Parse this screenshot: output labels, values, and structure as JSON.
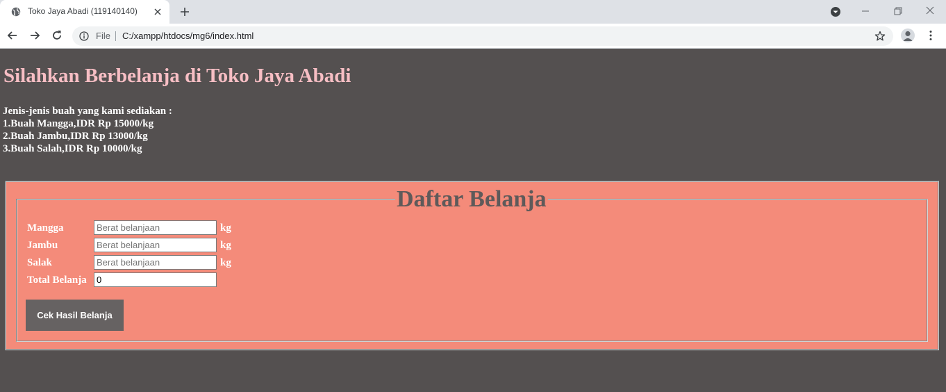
{
  "browser": {
    "tab_title": "Toko Jaya Abadi (119140140)",
    "address_scheme": "File",
    "url": "C:/xampp/htdocs/mg6/index.html"
  },
  "page": {
    "heading": "Silahkan Berbelanja di Toko Jaya Abadi",
    "intro": "Jenis-jenis buah yang kami sediakan :",
    "fruits": [
      "1.Buah Mangga,IDR Rp 15000/kg",
      "2.Buah Jambu,IDR Rp 13000/kg",
      "3.Buah Salah,IDR Rp 10000/kg"
    ],
    "colors": {
      "background": "#545050",
      "heading": "#f7bec4",
      "form_background": "#f48b7a",
      "legend": "#5e5a5a",
      "button": "#666262"
    }
  },
  "form": {
    "legend": "Daftar Belanja",
    "rows": [
      {
        "label": "Mangga",
        "placeholder": "Berat belanjaan",
        "value": "",
        "unit": "kg"
      },
      {
        "label": "Jambu",
        "placeholder": "Berat belanjaan",
        "value": "",
        "unit": "kg"
      },
      {
        "label": "Salak",
        "placeholder": "Berat belanjaan",
        "value": "",
        "unit": "kg"
      }
    ],
    "total": {
      "label": "Total Belanja",
      "value": "0"
    },
    "button_label": "Cek Hasil Belanja"
  }
}
